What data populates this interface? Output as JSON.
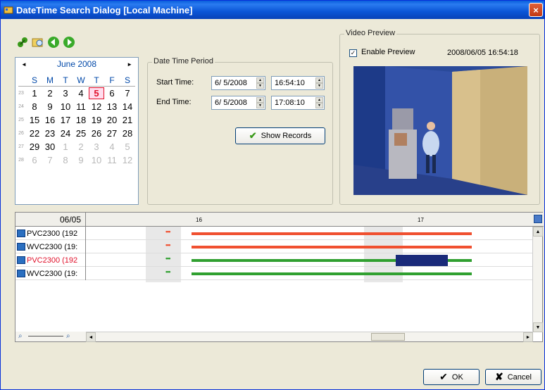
{
  "window": {
    "title": "DateTime Search Dialog  [Local Machine]",
    "close": "×"
  },
  "calendar": {
    "month_label": "June 2008",
    "prev": "◄",
    "next": "►",
    "dow": [
      "S",
      "M",
      "T",
      "W",
      "T",
      "F",
      "S"
    ],
    "weeks": [
      {
        "wk": "23",
        "days": [
          "1",
          "2",
          "3",
          "4",
          "5",
          "6",
          "7"
        ]
      },
      {
        "wk": "24",
        "days": [
          "8",
          "9",
          "10",
          "11",
          "12",
          "13",
          "14"
        ]
      },
      {
        "wk": "25",
        "days": [
          "15",
          "16",
          "17",
          "18",
          "19",
          "20",
          "21"
        ]
      },
      {
        "wk": "26",
        "days": [
          "22",
          "23",
          "24",
          "25",
          "26",
          "27",
          "28"
        ]
      },
      {
        "wk": "27",
        "days": [
          "29",
          "30",
          "1",
          "2",
          "3",
          "4",
          "5"
        ]
      },
      {
        "wk": "28",
        "days": [
          "6",
          "7",
          "8",
          "9",
          "10",
          "11",
          "12"
        ]
      }
    ],
    "selected_day": "5"
  },
  "period": {
    "group_label": "Date Time Period",
    "start_label": "Start Time:",
    "start_date": "6/ 5/2008",
    "start_time": "16:54:10",
    "end_label": "End Time:",
    "end_date": "6/ 5/2008",
    "end_time": "17:08:10",
    "show_records": "Show Records"
  },
  "preview": {
    "group_label": "Video Preview",
    "enable_label": "Enable Preview",
    "timestamp": "2008/06/05 16:54:18"
  },
  "timeline": {
    "date": "06/05",
    "tick_16": "16",
    "tick_17": "17",
    "cameras": [
      {
        "name": "PVC2300 (192",
        "alert": false
      },
      {
        "name": "WVC2300 (19:",
        "alert": false
      },
      {
        "name": "PVC2300 (192",
        "alert": true
      },
      {
        "name": "WVC2300 (19:",
        "alert": false
      }
    ]
  },
  "buttons": {
    "ok": "OK",
    "cancel": "Cancel"
  },
  "colors": {
    "titlebar": "#0a5fdc",
    "record_red": "#f05030",
    "record_green": "#30a030",
    "selection": "#1a2a7a"
  }
}
